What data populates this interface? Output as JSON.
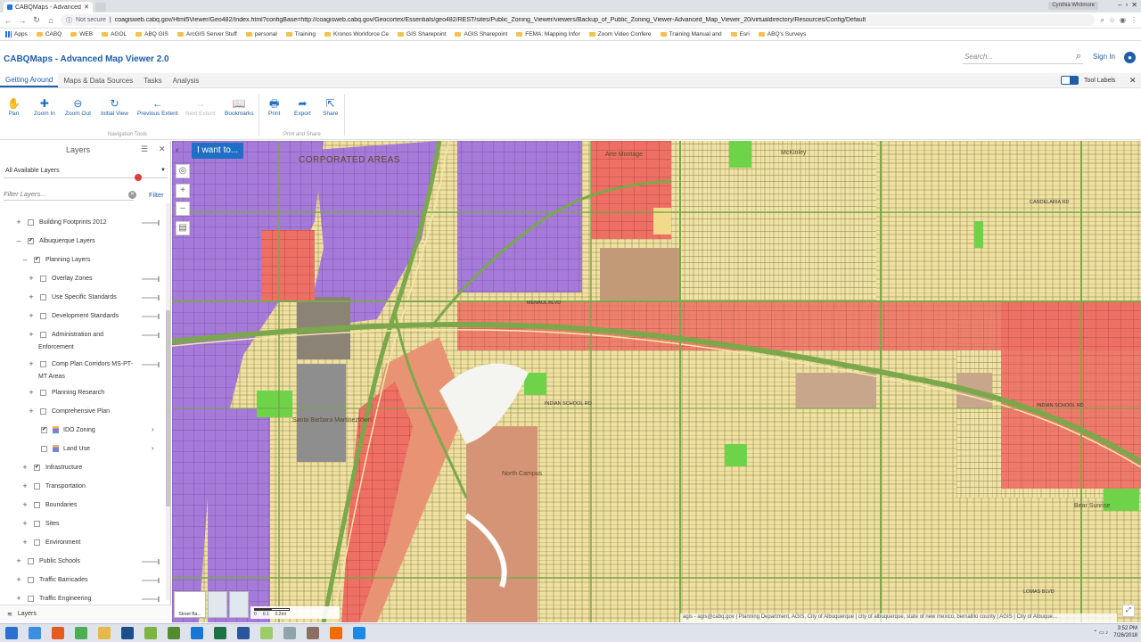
{
  "browser": {
    "tab_title": "CABQMaps - Advanced",
    "profile": "Cynthia Whitmore",
    "not_secure": "Not secure",
    "url": "coagisweb.cabq.gov/Html5Viewer/Geo482/Index.html?configBase=http://coagisweb.cabq.gov/Geocortex/Essentials/geo482/REST/sites/Public_Zoning_Viewer/viewers/Backup_of_Public_Zoning_Viewer-Advanced_Map_Viewer_20/virtualdirectory/Resources/Config/Default",
    "bookmarks": [
      "Apps",
      "CABQ",
      "WEB",
      "AGOL",
      "ABQ GIS",
      "ArcGIS Server Stuff",
      "personal",
      "Training",
      "Kronos Workforce Ce",
      "GIS Sharepoint",
      "AGIS Sharepoint",
      "FEMA: Mapping Infor",
      "Zoom Video Confere",
      "Training Manual and",
      "Esri",
      "ABQ's Surveys"
    ]
  },
  "app": {
    "title": "CABQMaps - Advanced Map Viewer 2.0",
    "search_placeholder": "Search...",
    "sign_in": "Sign In"
  },
  "ribbon": {
    "tabs": [
      "Getting Around",
      "Maps & Data Sources",
      "Tasks",
      "Analysis"
    ],
    "tool_labels": "Tool Labels",
    "tools": {
      "pan": "Pan",
      "zoom_in": "Zoom In",
      "zoom_out": "Zoom Out",
      "initial_view": "Initial View",
      "previous_extent": "Previous Extent",
      "next_extent": "Next Extent",
      "bookmarks": "Bookmarks",
      "print": "Print",
      "export": "Export",
      "share": "Share"
    },
    "groups": {
      "navigation": "Navigation Tools",
      "print_share": "Print and Share"
    }
  },
  "layers": {
    "title": "Layers",
    "selector": "All Available Layers",
    "filter_placeholder": "Filter Layers...",
    "filter_button": "Filter",
    "items": [
      {
        "label": "Building Footprints 2012"
      },
      {
        "label": "Albuquerque Layers"
      },
      {
        "label": "Planning Layers"
      },
      {
        "label": "Overlay Zones"
      },
      {
        "label": "Use Specific Standards"
      },
      {
        "label": "Development Standards"
      },
      {
        "label": "Administration and"
      },
      {
        "label": "Enforcement"
      },
      {
        "label": "Comp Plan Corridors MS-PT-"
      },
      {
        "label": "MT Areas"
      },
      {
        "label": "Planning Research"
      },
      {
        "label": "Comprehensive Plan"
      },
      {
        "label": "IDO Zoning"
      },
      {
        "label": "Land Use"
      },
      {
        "label": "Infrastructure"
      },
      {
        "label": "Transportation"
      },
      {
        "label": "Boundaries"
      },
      {
        "label": "Sites"
      },
      {
        "label": "Environment"
      },
      {
        "label": "Public Schools"
      },
      {
        "label": "Traffic Barricades"
      },
      {
        "label": "Traffic Engineering"
      }
    ],
    "footer": "Layers"
  },
  "map": {
    "i_want_to": "I want to...",
    "area_label": "CORPORATED AREAS",
    "place_labels": [
      "Arte Montage",
      "McKinley",
      "Santa Barbara Martineztown",
      "North Campus",
      "Bear Sunrise"
    ],
    "streets": [
      "MENAUL BLVD",
      "INDIAN SCHOOL RD",
      "CANDELARIA RD",
      "LOMAS BLVD",
      "INDIAN SCHOOL RD"
    ],
    "basemap_label": "Street Ba...",
    "scale_labels": [
      "0",
      "0.1",
      "0.2mi"
    ],
    "attribution": "agis - agis@cabq.gov | Planning Department, AGIS, City of Albuquerque | city of albuquerque, state of new mexico, bernalillo county | AGIS | City of Albuque..."
  },
  "taskbar": {
    "time": "3:52 PM",
    "date": "7/26/2018"
  }
}
